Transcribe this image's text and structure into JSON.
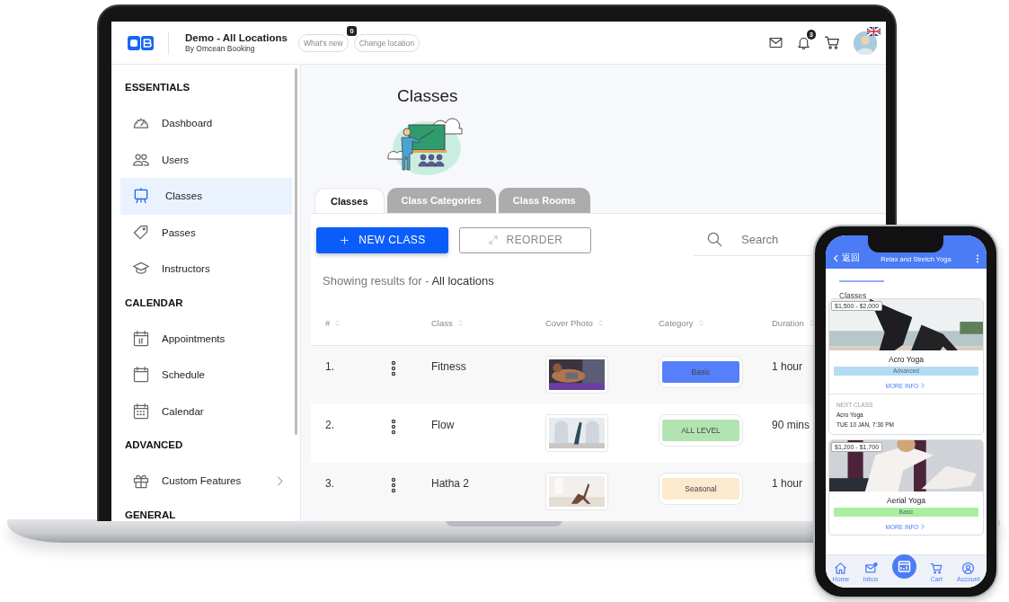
{
  "header": {
    "title": "Demo - All Locations",
    "subtitle": "By Omcean Booking",
    "whats_new": {
      "label": "What's new",
      "badge": "0"
    },
    "change_location": "Change location",
    "notification_badge": "3"
  },
  "sidebar": {
    "sections": [
      {
        "heading": "ESSENTIALS",
        "items": [
          {
            "label": "Dashboard",
            "selected": false,
            "expandable": false
          },
          {
            "label": "Users",
            "selected": false,
            "expandable": false
          },
          {
            "label": "Classes",
            "selected": true,
            "expandable": false
          },
          {
            "label": "Passes",
            "selected": false,
            "expandable": false
          },
          {
            "label": "Instructors",
            "selected": false,
            "expandable": false
          }
        ]
      },
      {
        "heading": "CALENDAR",
        "items": [
          {
            "label": "Appointments",
            "selected": false,
            "expandable": false
          },
          {
            "label": "Schedule",
            "selected": false,
            "expandable": false
          },
          {
            "label": "Calendar",
            "selected": false,
            "expandable": false
          }
        ]
      },
      {
        "heading": "ADVANCED",
        "items": [
          {
            "label": "Custom Features",
            "selected": false,
            "expandable": true
          }
        ]
      },
      {
        "heading": "GENERAL"
      }
    ]
  },
  "page": {
    "title": "Classes",
    "tabs": [
      {
        "label": "Classes",
        "selected": true
      },
      {
        "label": "Class Categories",
        "selected": false
      },
      {
        "label": "Class Rooms",
        "selected": false
      }
    ],
    "new_button": "NEW CLASS",
    "reorder_button": "REORDER",
    "search": {
      "placeholder": "Search"
    },
    "filter": {
      "prefix": "Showing results for -",
      "value": "All locations"
    },
    "table": {
      "columns": [
        "#",
        "Class",
        "Cover Photo",
        "Category",
        "Duration"
      ],
      "rows": [
        {
          "number": "1.",
          "class": "Fitness",
          "category": {
            "label": "Basic",
            "color": "#557ffb"
          },
          "duration": "1 hour"
        },
        {
          "number": "2.",
          "class": "Flow",
          "category": {
            "label": "ALL LEVEL",
            "color": "#b2e4b2"
          },
          "duration": "90 mins"
        },
        {
          "number": "3.",
          "class": "Hatha 2",
          "category": {
            "label": "Seasonal",
            "color": "#fde9cd"
          },
          "duration": "1 hour"
        }
      ]
    }
  },
  "phone": {
    "back": "返回",
    "title": "Relax and Stretch Yoga",
    "tab": "Classes",
    "cards": [
      {
        "price": "$1,500 - $2,000",
        "name": "Acro Yoga",
        "level": {
          "label": "Advanced",
          "color": "#b3dcf3"
        },
        "more_info": "MORE INFO",
        "next_class": {
          "heading": "NEXT CLASS",
          "name": "Acro Yoga",
          "time": "TUE 10 JAN, 7:30 PM"
        }
      },
      {
        "price": "$1,200 - $1,700",
        "name": "Aerial Yoga",
        "level": {
          "label": "Basic",
          "color": "#a9ef9f"
        },
        "more_info": "MORE INFO"
      }
    ],
    "nav": [
      "Home",
      "Inbox",
      "Cart",
      "Account"
    ]
  }
}
